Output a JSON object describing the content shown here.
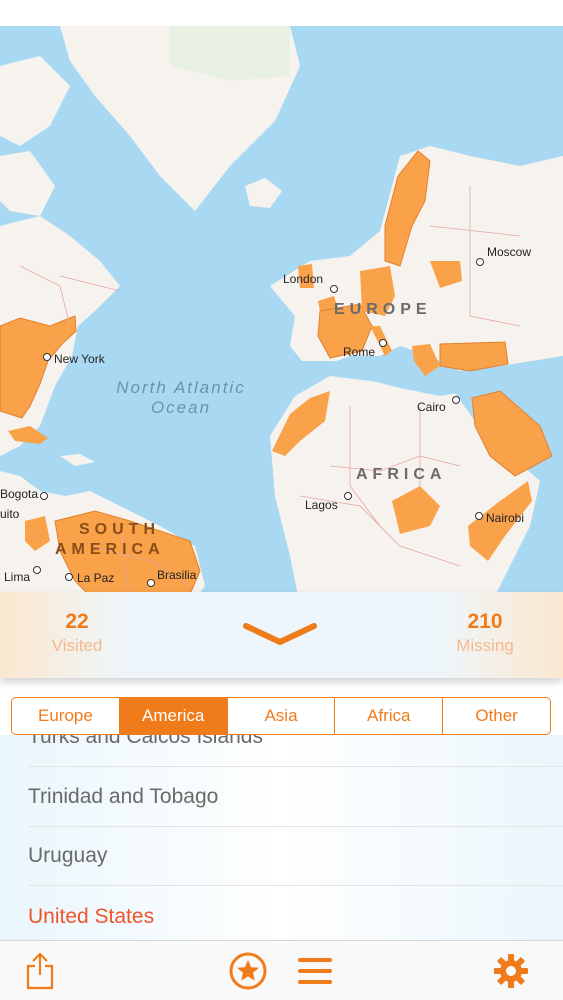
{
  "map": {
    "labels": {
      "moscow": "Moscow",
      "london": "London",
      "europe": "EUROPE",
      "rome": "Rome",
      "new_york": "New York",
      "ocean_line1": "North Atlantic",
      "ocean_line2": "Ocean",
      "cairo": "Cairo",
      "africa": "AFRICA",
      "lagos": "Lagos",
      "nairobi": "Nairobi",
      "bogota": "Bogota",
      "quito": "uito",
      "south_america_line1": "SOUTH",
      "south_america_line2": "AMERICA",
      "lima": "Lima",
      "la_paz": "La Paz",
      "brasilia": "Brasilia"
    },
    "colors": {
      "water": "#a9d9f2",
      "land": "#f6f3ee",
      "visited": "#f9a24a",
      "border": "#e6a5a5"
    }
  },
  "stats": {
    "visited_count": "22",
    "visited_label": "Visited",
    "missing_count": "210",
    "missing_label": "Missing",
    "toggle_icon": "chevron-down-icon"
  },
  "segments": {
    "items": [
      {
        "label": "Europe",
        "active": false
      },
      {
        "label": "America",
        "active": true
      },
      {
        "label": "Asia",
        "active": false
      },
      {
        "label": "Africa",
        "active": false
      },
      {
        "label": "Other",
        "active": false
      }
    ]
  },
  "list": {
    "items": [
      {
        "label": "Turks and Caicos Islands",
        "visited": false
      },
      {
        "label": "Trinidad and Tobago",
        "visited": false
      },
      {
        "label": "Uruguay",
        "visited": false
      },
      {
        "label": "United States",
        "visited": true
      }
    ]
  },
  "tabbar": {
    "icons": [
      "share-icon",
      "star-badge-icon",
      "hamburger-menu-icon",
      "gear-icon"
    ]
  },
  "theme": {
    "accent": "#f07b1a",
    "selected_text": "#f0542a"
  }
}
